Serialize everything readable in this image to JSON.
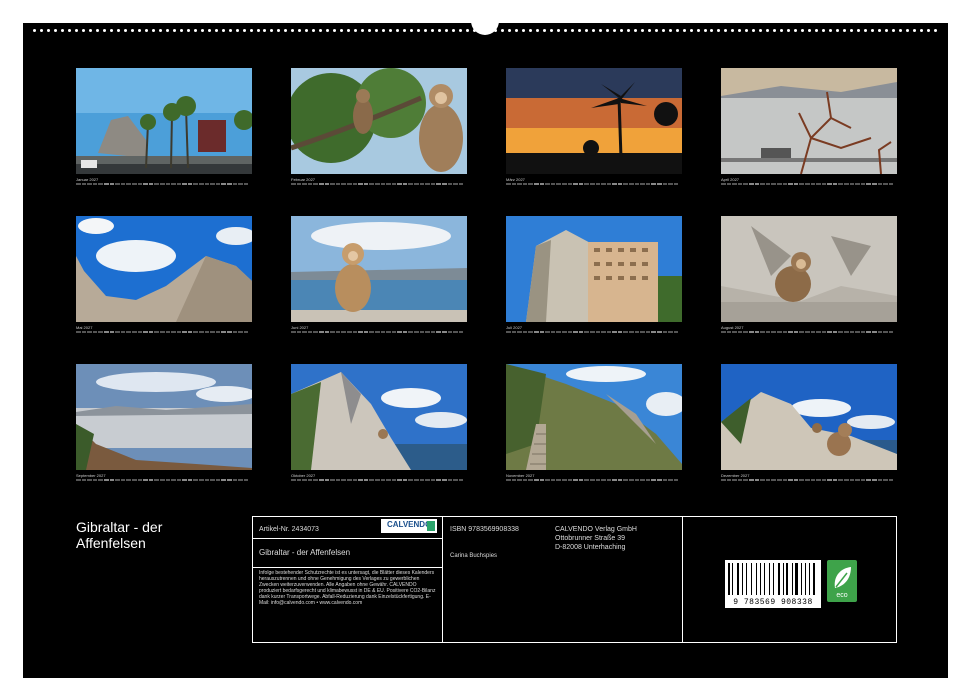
{
  "calendar": {
    "title": "Gibraltar - der Affenfelsen",
    "months": [
      {
        "label": "Januar 2027",
        "scene": "rock-road-palms"
      },
      {
        "label": "Februar 2027",
        "scene": "macaques-in-tree"
      },
      {
        "label": "März 2027",
        "scene": "palm-sunset"
      },
      {
        "label": "April 2027",
        "scene": "harbour-branches"
      },
      {
        "label": "Mai 2027",
        "scene": "rocky-ridge-sky"
      },
      {
        "label": "Juni 2027",
        "scene": "macaque-on-rail"
      },
      {
        "label": "Juli 2027",
        "scene": "rock-and-tower"
      },
      {
        "label": "August 2027",
        "scene": "macaque-on-rocks"
      },
      {
        "label": "September 2027",
        "scene": "sea-view-haze"
      },
      {
        "label": "Oktober 2027",
        "scene": "rock-peak-sea"
      },
      {
        "label": "November 2027",
        "scene": "stairs-hillside"
      },
      {
        "label": "Dezember 2027",
        "scene": "macaques-on-cliff"
      }
    ]
  },
  "info": {
    "article_no": "Artikel-Nr. 2434073",
    "logo_text": "CALVENDO",
    "product_title": "Gibraltar - der Affenfelsen",
    "legal_text": "Infolge bestehender Schutzrechte ist es untersagt, die Blätter dieses Kalenders herauszutrennen und ohne Genehmigung des Verlages zu gewerblichen Zwecken weiterzuverwenden. Alle Angaben ohne Gewähr. CALVENDO produziert bedarfsgerecht und klimabewusst in DE & EU. Positivere CO2-Bilanz dank kurzer Transportwege. Abfall-Reduzierung dank Einzelstückfertigung. E-Mail: info@calvendo.com • www.calvendo.com",
    "isbn": "ISBN 9783569908338",
    "author": "Carina Buchspies",
    "publisher_name": "CALVENDO Verlag GmbH",
    "publisher_street": "Ottobrunner Straße 39",
    "publisher_city": "D-82008 Unterhaching",
    "barcode_digits": "9 783569 908338",
    "eco_label": "eco"
  }
}
